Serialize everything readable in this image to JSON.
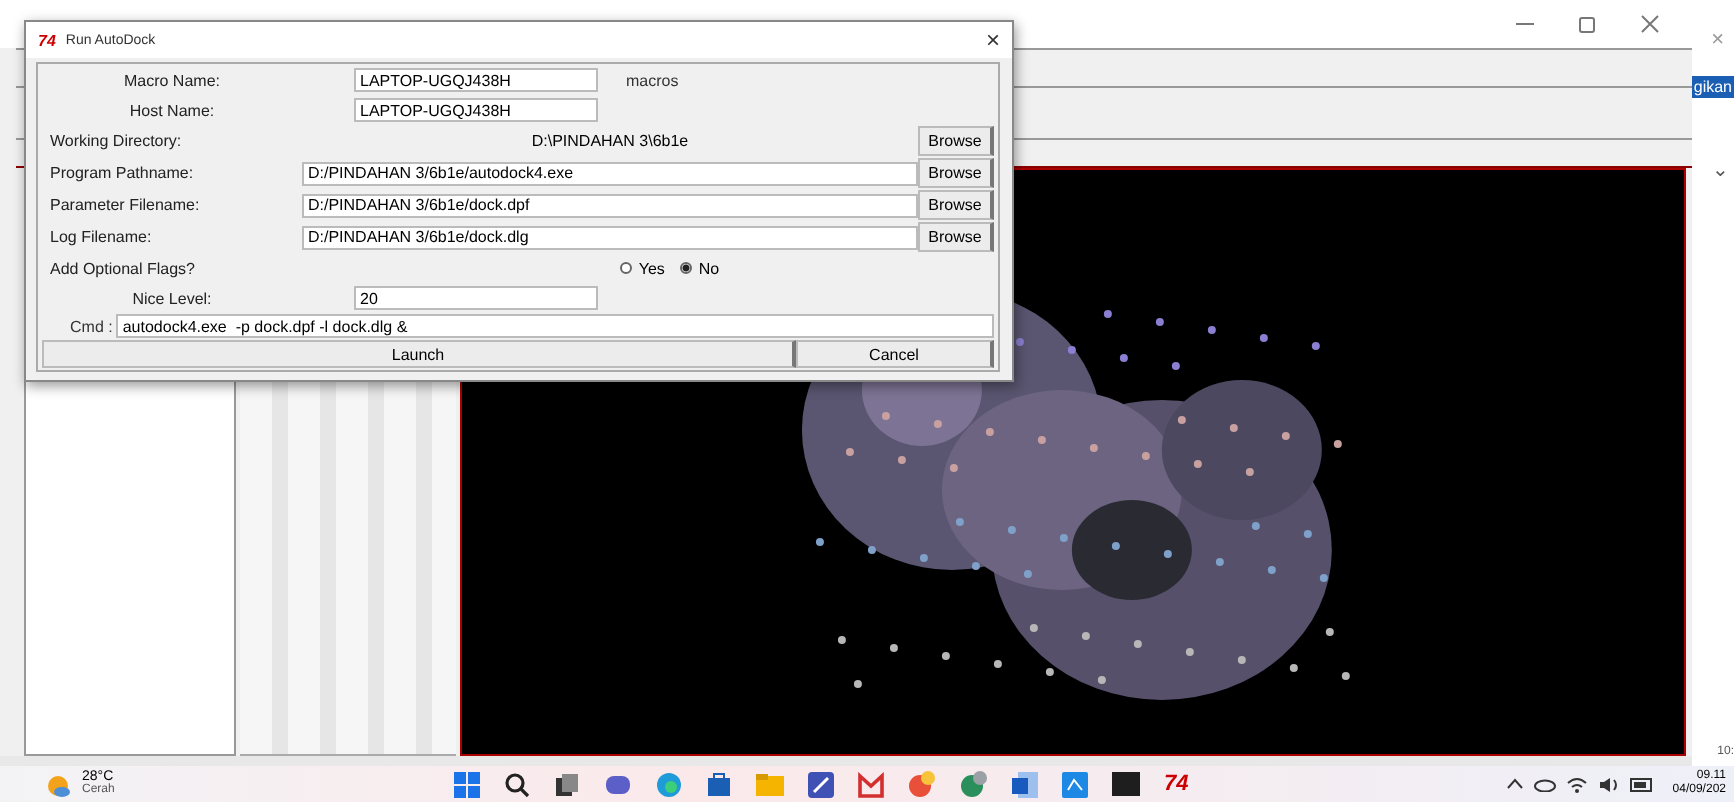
{
  "dialog": {
    "logo": "74",
    "title": "Run AutoDock",
    "close": "×",
    "rows": [
      {
        "kind": "short",
        "label": "Macro Name:",
        "value": "LAPTOP-UGQJ438H",
        "note": "macros"
      },
      {
        "kind": "short",
        "label": "Host Name:",
        "value": "LAPTOP-UGQJ438H"
      },
      {
        "kind": "text",
        "label": "Working Directory:",
        "value": "D:\\PINDAHAN 3\\6b1e",
        "button": "Browse"
      },
      {
        "kind": "path",
        "label": "Program Pathname:",
        "value": "D:/PINDAHAN 3/6b1e/autodock4.exe",
        "button": "Browse"
      },
      {
        "kind": "path",
        "label": "Parameter Filename:",
        "value": "D:/PINDAHAN 3/6b1e/dock.dpf",
        "button": "Browse"
      },
      {
        "kind": "path",
        "label": "Log Filename:",
        "value": "D:/PINDAHAN 3/6b1e/dock.dlg",
        "button": "Browse"
      },
      {
        "kind": "radio",
        "label": "Add Optional Flags?",
        "options": [
          {
            "label": "Yes",
            "selected": false
          },
          {
            "label": "No",
            "selected": true
          }
        ]
      },
      {
        "kind": "short",
        "label": "Nice Level:",
        "value": "20"
      }
    ],
    "cmd_label": "Cmd :",
    "cmd": "autodock4.exe  -p dock.dpf -l dock.dlg &",
    "buttons": [
      "Launch",
      "Cancel"
    ]
  },
  "side_window": {
    "button": "gikan",
    "close": "×",
    "chevron": "⌄",
    "corner": "10:"
  },
  "taskbar": {
    "temperature": "28°C",
    "weather": "Cerah",
    "app_logo": "74",
    "time": "09.11",
    "date": "04/09/202"
  }
}
